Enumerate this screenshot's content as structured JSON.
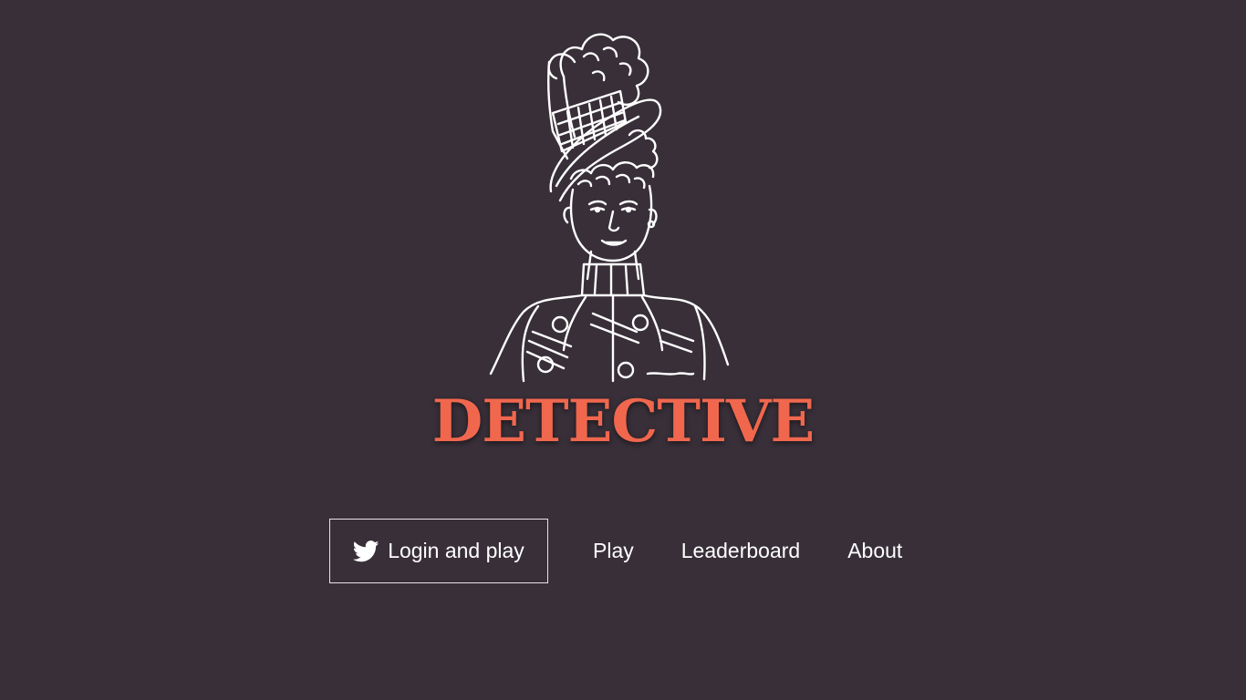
{
  "page": {
    "background_color": "#382f38",
    "accent_color": "#f0674e"
  },
  "hero": {
    "illustration_icon": "victorian-lady-portrait",
    "title": "DETECTIVE"
  },
  "nav": {
    "login_icon": "twitter-bird-icon",
    "login_label": "Login and play",
    "play_label": "Play",
    "leaderboard_label": "Leaderboard",
    "about_label": "About"
  }
}
